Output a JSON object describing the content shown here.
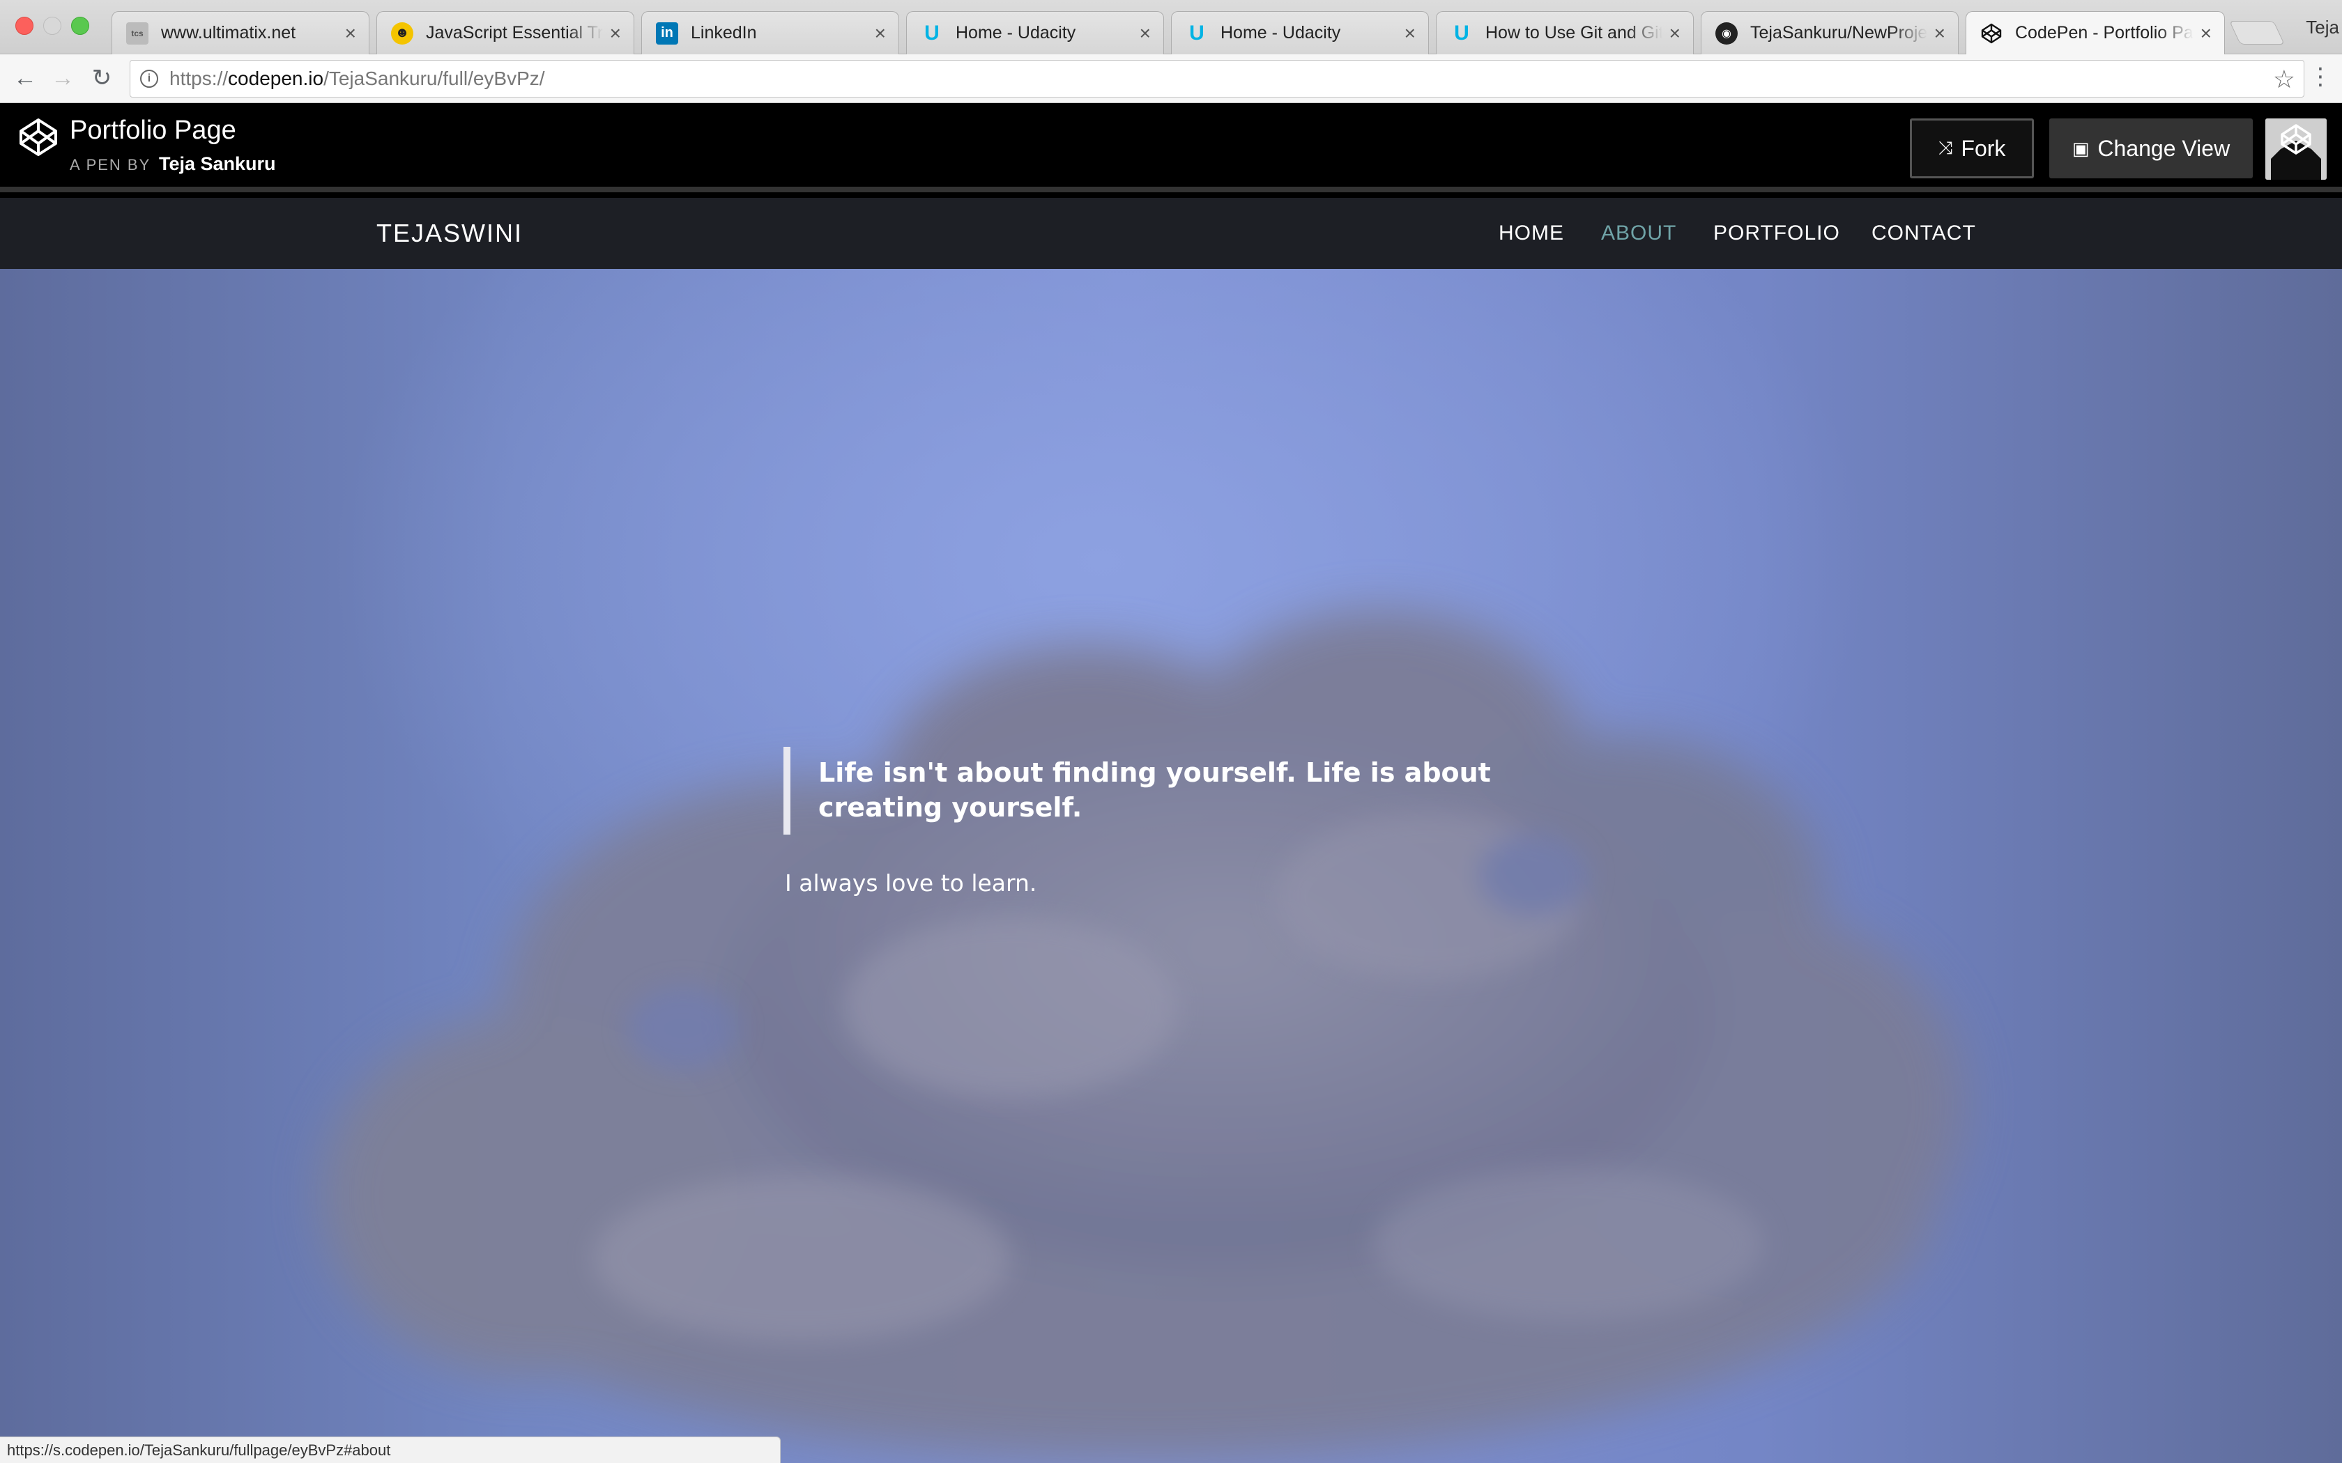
{
  "browser": {
    "tabs": [
      {
        "title": "www.ultimatix.net",
        "favicon": "ultimatix-icon"
      },
      {
        "title": "JavaScript Essential Training",
        "favicon": "lynda-icon"
      },
      {
        "title": "LinkedIn",
        "favicon": "linkedin-icon"
      },
      {
        "title": "Home - Udacity",
        "favicon": "udacity-icon"
      },
      {
        "title": "Home - Udacity",
        "favicon": "udacity-icon"
      },
      {
        "title": "How to Use Git and GitHub",
        "favicon": "udacity-icon"
      },
      {
        "title": "TejaSankuru/NewProject",
        "favicon": "github-icon"
      },
      {
        "title": "CodePen - Portfolio Page",
        "favicon": "codepen-icon",
        "active": true
      }
    ],
    "profile_name": "Teja",
    "url": {
      "prefix": "https://",
      "host": "codepen.io",
      "path": "/TejaSankuru/full/eyBvPz/"
    },
    "status_url": "https://s.codepen.io/TejaSankuru/fullpage/eyBvPz#about"
  },
  "codepen": {
    "pen_title": "Portfolio Page",
    "byline_prefix": "A PEN BY",
    "author": "Teja Sankuru",
    "fork_label": "Fork",
    "change_view_label": "Change View"
  },
  "site": {
    "brand": "TEJASWINI",
    "nav": [
      {
        "label": "HOME",
        "active": false
      },
      {
        "label": "ABOUT",
        "active": true
      },
      {
        "label": "PORTFOLIO",
        "active": false
      },
      {
        "label": "CONTACT",
        "active": false
      }
    ],
    "quote": "Life isn't about finding yourself. Life is about creating yourself.",
    "subtext": "I always love to learn."
  },
  "colors": {
    "nav_active": "#70a4a8",
    "hero_sky": "#7f91d3",
    "nav_bg": "#1d1f25"
  }
}
